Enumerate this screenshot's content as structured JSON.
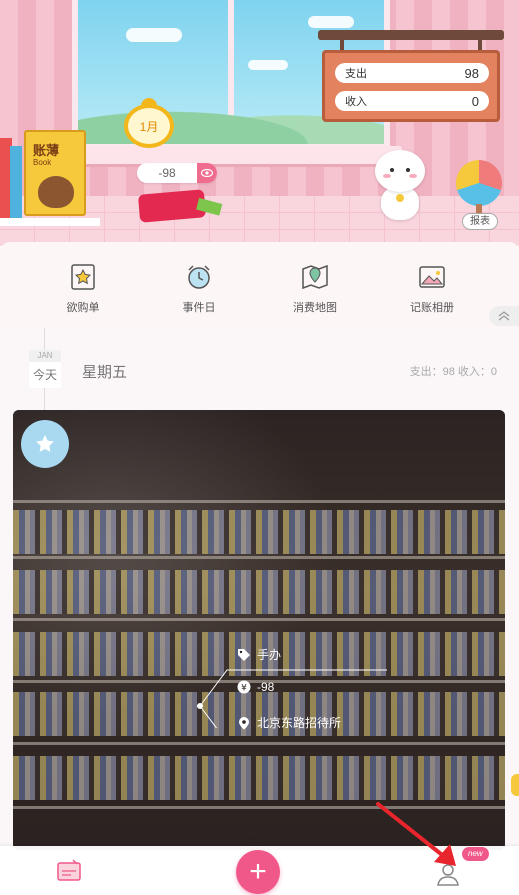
{
  "header": {
    "book_title": "账薄",
    "book_subtitle": "Book",
    "month_badge": "1月",
    "money_amount": "-98",
    "sign": {
      "expense_label": "支出",
      "expense_value": "98",
      "income_label": "收入",
      "income_value": "0"
    },
    "report_label": "报表"
  },
  "shortcuts": [
    {
      "label": "欲购单",
      "icon": "wishlist-star-icon"
    },
    {
      "label": "事件日",
      "icon": "alarm-clock-icon"
    },
    {
      "label": "消费地图",
      "icon": "map-pin-icon"
    },
    {
      "label": "记账相册",
      "icon": "photo-album-icon"
    }
  ],
  "day": {
    "month_abbr": "JAN",
    "day_label": "今天",
    "weekday": "星期五",
    "summary": "支出：98  收入：0"
  },
  "entry": {
    "category": "手办",
    "amount": "-98",
    "location": "北京东路招待所"
  },
  "bottom_nav": {
    "add_label": "+",
    "new_badge": "new"
  },
  "colors": {
    "accent": "#f0588a",
    "wall_pink": "#f3b8c6",
    "sign_orange": "#e2825e",
    "star_badge": "#a9d8f1"
  }
}
